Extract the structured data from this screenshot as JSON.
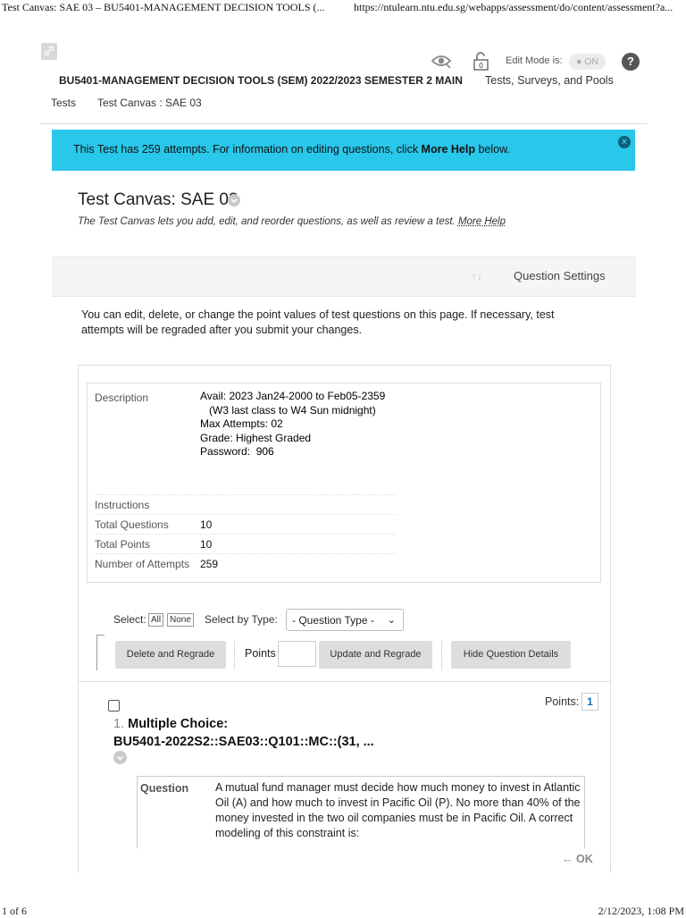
{
  "print": {
    "header_title": "Test Canvas: SAE 03 – BU5401-MANAGEMENT DECISION TOOLS (...",
    "header_url": "https://ntulearn.ntu.edu.sg/webapps/assessment/do/content/assessment?a...",
    "footer_page": "1 of 6",
    "footer_datetime": "2/12/2023, 1:08 PM"
  },
  "header": {
    "course_title": "BU5401-MANAGEMENT DECISION TOOLS (SEM) 2022/2023 SEMESTER 2 MAIN",
    "tool_link": "Tests, Surveys, and Pools",
    "edit_mode_label": "Edit Mode is:",
    "edit_mode_value": "ON",
    "help_label": "?",
    "lock_badge": "0"
  },
  "breadcrumb": {
    "item1": "Tests",
    "item2": "Test Canvas : SAE 03"
  },
  "banner": {
    "text_before": "This Test has 259 attempts. For information on editing questions, click ",
    "link": "More Help",
    "text_after": " below.",
    "close": "×"
  },
  "page": {
    "title": "Test Canvas: SAE 03",
    "subtitle": "The Test Canvas lets you add, edit, and reorder questions, as well as review a test. ",
    "subtitle_link": "More Help",
    "question_settings": "Question Settings",
    "intro": "You can edit, delete, or change the point values of test questions on this page. If necessary, test attempts will be regraded after you submit your changes."
  },
  "description": {
    "label": "Description",
    "avail_lines": "Avail: 2023 Jan24-2000 to Feb05-2359\n   (W3 last class to W4 Sun midnight)\nMax Attempts: 02\nGrade: Highest Graded\nPassword:  906",
    "instructions_label": "Instructions",
    "total_questions_label": "Total Questions",
    "total_questions": "10",
    "total_points_label": "Total Points",
    "total_points": "10",
    "attempts_label": "Number of Attempts",
    "attempts": "259"
  },
  "toolbar": {
    "select_label": "Select:",
    "all": "All",
    "none": "None",
    "by_type_label": "Select by Type:",
    "question_type": "- Question Type -",
    "delete_regrade": "Delete and Regrade",
    "points_label": "Points",
    "update_regrade": "Update and Regrade",
    "hide_details": "Hide Question Details"
  },
  "question": {
    "points_label": "Points:",
    "points": "1",
    "number": "1.",
    "type": "Multiple Choice:",
    "code": "BU5401-2022S2::SAE03::Q101::MC::(31, ...",
    "field_label": "Question",
    "text": "A mutual fund manager must decide how much money to invest in Atlantic Oil (A) and how much to invest in Pacific Oil (P). No more than 40% of the money invested in the two oil companies must be in Pacific Oil. A correct modeling of this constraint is:",
    "back_ok": "← OK"
  },
  "colors": {
    "banner": "#29c7ea",
    "link_blue": "#1a6fb5"
  },
  "icons": [
    "chain-link-icon",
    "eye-icon",
    "unlock-icon",
    "help-icon",
    "close-icon",
    "chevron-down-icon",
    "sort-icon",
    "bracket-arrow-icon"
  ]
}
